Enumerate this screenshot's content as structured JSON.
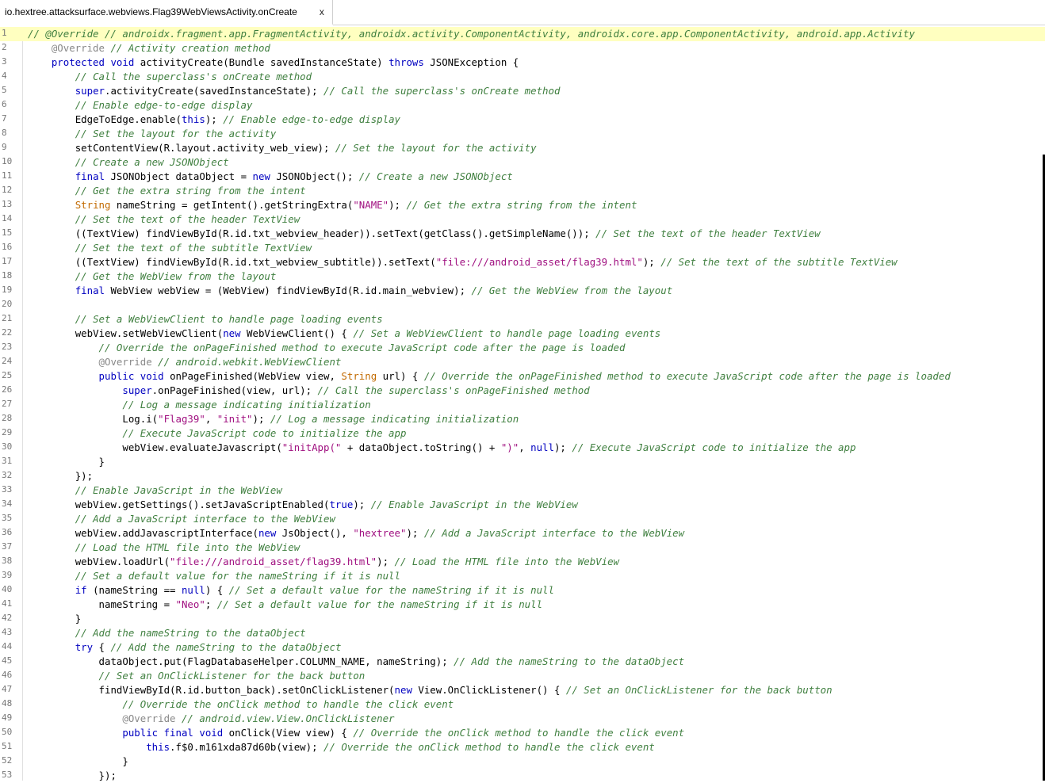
{
  "tab": {
    "title": "io.hextree.attacksurface.webviews.Flag39WebViewsActivity.onCreate",
    "close": "x"
  },
  "highlight_line": 1,
  "lines": [
    {
      "n": "1",
      "indent": 0,
      "parts": [
        [
          "c",
          "// @Override // androidx.fragment.app.FragmentActivity, androidx.activity.ComponentActivity, androidx.core.app.ComponentActivity, android.app.Activity"
        ]
      ]
    },
    {
      "n": "2",
      "indent": 1,
      "parts": [
        [
          "a",
          "@Override"
        ],
        [
          "p",
          " "
        ],
        [
          "c",
          "// Activity creation method"
        ]
      ]
    },
    {
      "n": "3",
      "indent": 1,
      "parts": [
        [
          "k",
          "protected"
        ],
        [
          "p",
          " "
        ],
        [
          "k",
          "void"
        ],
        [
          "p",
          " activityCreate(Bundle savedInstanceState) "
        ],
        [
          "k",
          "throws"
        ],
        [
          "p",
          " JSONException {"
        ]
      ]
    },
    {
      "n": "4",
      "indent": 2,
      "parts": [
        [
          "c",
          "// Call the superclass's onCreate method"
        ]
      ]
    },
    {
      "n": "5",
      "indent": 2,
      "parts": [
        [
          "k",
          "super"
        ],
        [
          "p",
          ".activityCreate(savedInstanceState); "
        ],
        [
          "c",
          "// Call the superclass's onCreate method"
        ]
      ]
    },
    {
      "n": "6",
      "indent": 2,
      "parts": [
        [
          "c",
          "// Enable edge-to-edge display"
        ]
      ]
    },
    {
      "n": "7",
      "indent": 2,
      "parts": [
        [
          "p",
          "EdgeToEdge.enable("
        ],
        [
          "k",
          "this"
        ],
        [
          "p",
          "); "
        ],
        [
          "c",
          "// Enable edge-to-edge display"
        ]
      ]
    },
    {
      "n": "8",
      "indent": 2,
      "parts": [
        [
          "c",
          "// Set the layout for the activity"
        ]
      ]
    },
    {
      "n": "9",
      "indent": 2,
      "parts": [
        [
          "p",
          "setContentView(R.layout.activity_web_view); "
        ],
        [
          "c",
          "// Set the layout for the activity"
        ]
      ]
    },
    {
      "n": "10",
      "indent": 2,
      "parts": [
        [
          "c",
          "// Create a new JSONObject"
        ]
      ]
    },
    {
      "n": "11",
      "indent": 2,
      "parts": [
        [
          "k",
          "final"
        ],
        [
          "p",
          " JSONObject dataObject = "
        ],
        [
          "k",
          "new"
        ],
        [
          "p",
          " JSONObject(); "
        ],
        [
          "c",
          "// Create a new JSONObject"
        ]
      ]
    },
    {
      "n": "12",
      "indent": 2,
      "parts": [
        [
          "c",
          "// Get the extra string from the intent"
        ]
      ]
    },
    {
      "n": "13",
      "indent": 2,
      "parts": [
        [
          "t",
          "String"
        ],
        [
          "p",
          " nameString = getIntent().getStringExtra("
        ],
        [
          "s",
          "\"NAME\""
        ],
        [
          "p",
          "); "
        ],
        [
          "c",
          "// Get the extra string from the intent"
        ]
      ]
    },
    {
      "n": "14",
      "indent": 2,
      "parts": [
        [
          "c",
          "// Set the text of the header TextView"
        ]
      ]
    },
    {
      "n": "15",
      "indent": 2,
      "parts": [
        [
          "p",
          "((TextView) findViewById(R.id.txt_webview_header)).setText(getClass().getSimpleName()); "
        ],
        [
          "c",
          "// Set the text of the header TextView"
        ]
      ]
    },
    {
      "n": "16",
      "indent": 2,
      "parts": [
        [
          "c",
          "// Set the text of the subtitle TextView"
        ]
      ]
    },
    {
      "n": "17",
      "indent": 2,
      "parts": [
        [
          "p",
          "((TextView) findViewById(R.id.txt_webview_subtitle)).setText("
        ],
        [
          "s",
          "\"file:///android_asset/flag39.html\""
        ],
        [
          "p",
          "); "
        ],
        [
          "c",
          "// Set the text of the subtitle TextView"
        ]
      ]
    },
    {
      "n": "18",
      "indent": 2,
      "parts": [
        [
          "c",
          "// Get the WebView from the layout"
        ]
      ]
    },
    {
      "n": "19",
      "indent": 2,
      "parts": [
        [
          "k",
          "final"
        ],
        [
          "p",
          " WebView webView = (WebView) findViewById(R.id.main_webview); "
        ],
        [
          "c",
          "// Get the WebView from the layout"
        ]
      ]
    },
    {
      "n": "20",
      "indent": 0,
      "parts": []
    },
    {
      "n": "21",
      "indent": 2,
      "parts": [
        [
          "c",
          "// Set a WebViewClient to handle page loading events"
        ]
      ]
    },
    {
      "n": "22",
      "indent": 2,
      "parts": [
        [
          "p",
          "webView.setWebViewClient("
        ],
        [
          "k",
          "new"
        ],
        [
          "p",
          " WebViewClient() { "
        ],
        [
          "c",
          "// Set a WebViewClient to handle page loading events"
        ]
      ]
    },
    {
      "n": "23",
      "indent": 3,
      "parts": [
        [
          "c",
          "// Override the onPageFinished method to execute JavaScript code after the page is loaded"
        ]
      ]
    },
    {
      "n": "24",
      "indent": 3,
      "parts": [
        [
          "a",
          "@Override"
        ],
        [
          "p",
          " "
        ],
        [
          "c",
          "// android.webkit.WebViewClient"
        ]
      ]
    },
    {
      "n": "25",
      "indent": 3,
      "parts": [
        [
          "k",
          "public"
        ],
        [
          "p",
          " "
        ],
        [
          "k",
          "void"
        ],
        [
          "p",
          " onPageFinished(WebView view, "
        ],
        [
          "t",
          "String"
        ],
        [
          "p",
          " url) { "
        ],
        [
          "c",
          "// Override the onPageFinished method to execute JavaScript code after the page is loaded"
        ]
      ]
    },
    {
      "n": "26",
      "indent": 4,
      "parts": [
        [
          "k",
          "super"
        ],
        [
          "p",
          ".onPageFinished(view, url); "
        ],
        [
          "c",
          "// Call the superclass's onPageFinished method"
        ]
      ]
    },
    {
      "n": "27",
      "indent": 4,
      "parts": [
        [
          "c",
          "// Log a message indicating initialization"
        ]
      ]
    },
    {
      "n": "28",
      "indent": 4,
      "parts": [
        [
          "p",
          "Log.i("
        ],
        [
          "s",
          "\"Flag39\""
        ],
        [
          "p",
          ", "
        ],
        [
          "s",
          "\"init\""
        ],
        [
          "p",
          "); "
        ],
        [
          "c",
          "// Log a message indicating initialization"
        ]
      ]
    },
    {
      "n": "29",
      "indent": 4,
      "parts": [
        [
          "c",
          "// Execute JavaScript code to initialize the app"
        ]
      ]
    },
    {
      "n": "30",
      "indent": 4,
      "parts": [
        [
          "p",
          "webView.evaluateJavascript("
        ],
        [
          "s",
          "\"initApp(\""
        ],
        [
          "p",
          " + dataObject.toString() + "
        ],
        [
          "s",
          "\")\""
        ],
        [
          "p",
          ", "
        ],
        [
          "k",
          "null"
        ],
        [
          "p",
          "); "
        ],
        [
          "c",
          "// Execute JavaScript code to initialize the app"
        ]
      ]
    },
    {
      "n": "31",
      "indent": 3,
      "parts": [
        [
          "p",
          "}"
        ]
      ]
    },
    {
      "n": "32",
      "indent": 2,
      "parts": [
        [
          "p",
          "});"
        ]
      ]
    },
    {
      "n": "33",
      "indent": 2,
      "parts": [
        [
          "c",
          "// Enable JavaScript in the WebView"
        ]
      ]
    },
    {
      "n": "34",
      "indent": 2,
      "parts": [
        [
          "p",
          "webView.getSettings().setJavaScriptEnabled("
        ],
        [
          "k",
          "true"
        ],
        [
          "p",
          "); "
        ],
        [
          "c",
          "// Enable JavaScript in the WebView"
        ]
      ]
    },
    {
      "n": "35",
      "indent": 2,
      "parts": [
        [
          "c",
          "// Add a JavaScript interface to the WebView"
        ]
      ]
    },
    {
      "n": "36",
      "indent": 2,
      "parts": [
        [
          "p",
          "webView.addJavascriptInterface("
        ],
        [
          "k",
          "new"
        ],
        [
          "p",
          " JsObject(), "
        ],
        [
          "s",
          "\"hextree\""
        ],
        [
          "p",
          "); "
        ],
        [
          "c",
          "// Add a JavaScript interface to the WebView"
        ]
      ]
    },
    {
      "n": "37",
      "indent": 2,
      "parts": [
        [
          "c",
          "// Load the HTML file into the WebView"
        ]
      ]
    },
    {
      "n": "38",
      "indent": 2,
      "parts": [
        [
          "p",
          "webView.loadUrl("
        ],
        [
          "s",
          "\"file:///android_asset/flag39.html\""
        ],
        [
          "p",
          "); "
        ],
        [
          "c",
          "// Load the HTML file into the WebView"
        ]
      ]
    },
    {
      "n": "39",
      "indent": 2,
      "parts": [
        [
          "c",
          "// Set a default value for the nameString if it is null"
        ]
      ]
    },
    {
      "n": "40",
      "indent": 2,
      "parts": [
        [
          "k",
          "if"
        ],
        [
          "p",
          " (nameString == "
        ],
        [
          "k",
          "null"
        ],
        [
          "p",
          ") { "
        ],
        [
          "c",
          "// Set a default value for the nameString if it is null"
        ]
      ]
    },
    {
      "n": "41",
      "indent": 3,
      "parts": [
        [
          "p",
          "nameString = "
        ],
        [
          "s",
          "\"Neo\""
        ],
        [
          "p",
          "; "
        ],
        [
          "c",
          "// Set a default value for the nameString if it is null"
        ]
      ]
    },
    {
      "n": "42",
      "indent": 2,
      "parts": [
        [
          "p",
          "}"
        ]
      ]
    },
    {
      "n": "43",
      "indent": 2,
      "parts": [
        [
          "c",
          "// Add the nameString to the dataObject"
        ]
      ]
    },
    {
      "n": "44",
      "indent": 2,
      "parts": [
        [
          "k",
          "try"
        ],
        [
          "p",
          " { "
        ],
        [
          "c",
          "// Add the nameString to the dataObject"
        ]
      ]
    },
    {
      "n": "45",
      "indent": 3,
      "parts": [
        [
          "p",
          "dataObject.put(FlagDatabaseHelper.COLUMN_NAME, nameString); "
        ],
        [
          "c",
          "// Add the nameString to the dataObject"
        ]
      ]
    },
    {
      "n": "46",
      "indent": 3,
      "parts": [
        [
          "c",
          "// Set an OnClickListener for the back button"
        ]
      ]
    },
    {
      "n": "47",
      "indent": 3,
      "parts": [
        [
          "p",
          "findViewById(R.id.button_back).setOnClickListener("
        ],
        [
          "k",
          "new"
        ],
        [
          "p",
          " View.OnClickListener() { "
        ],
        [
          "c",
          "// Set an OnClickListener for the back button"
        ]
      ]
    },
    {
      "n": "48",
      "indent": 4,
      "parts": [
        [
          "c",
          "// Override the onClick method to handle the click event"
        ]
      ]
    },
    {
      "n": "49",
      "indent": 4,
      "parts": [
        [
          "a",
          "@Override"
        ],
        [
          "p",
          " "
        ],
        [
          "c",
          "// android.view.View.OnClickListener"
        ]
      ]
    },
    {
      "n": "50",
      "indent": 4,
      "parts": [
        [
          "k",
          "public"
        ],
        [
          "p",
          " "
        ],
        [
          "k",
          "final"
        ],
        [
          "p",
          " "
        ],
        [
          "k",
          "void"
        ],
        [
          "p",
          " onClick(View view) { "
        ],
        [
          "c",
          "// Override the onClick method to handle the click event"
        ]
      ]
    },
    {
      "n": "51",
      "indent": 5,
      "parts": [
        [
          "k",
          "this"
        ],
        [
          "p",
          ".f$0.m161xda87d60b(view); "
        ],
        [
          "c",
          "// Override the onClick method to handle the click event"
        ]
      ]
    },
    {
      "n": "52",
      "indent": 4,
      "parts": [
        [
          "p",
          "}"
        ]
      ]
    },
    {
      "n": "53",
      "indent": 3,
      "parts": [
        [
          "p",
          "});"
        ]
      ]
    }
  ]
}
